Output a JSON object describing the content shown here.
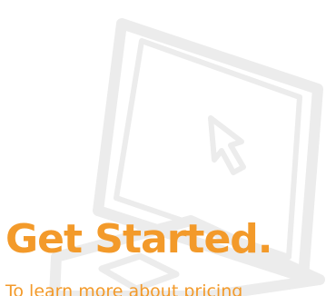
{
  "hero": {
    "illustration": "laptop-icon",
    "cursor_icon": "cursor-arrow-icon",
    "heading": "Get Started.",
    "subtext": "To learn more about pricing"
  },
  "colors": {
    "accent": "#f39a2a",
    "background": "#ffffff",
    "illustration_stroke": "#ececec"
  }
}
